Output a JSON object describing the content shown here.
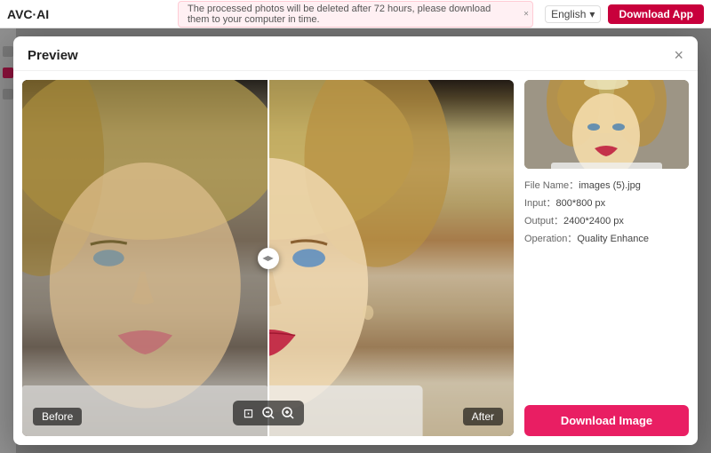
{
  "topbar": {
    "logo": "AVC·AI",
    "notification": "The processed photos will be deleted after 72 hours, please download them to your computer in time.",
    "notification_close": "×",
    "language": "English",
    "language_chevron": "▾",
    "download_app": "Download App"
  },
  "modal": {
    "title": "Preview",
    "close": "×",
    "label_before": "Before",
    "label_after": "After",
    "zoom_fit": "⊡",
    "zoom_out": "−",
    "zoom_in": "−"
  },
  "file_info": {
    "name_label": "File Name：",
    "name_value": "images (5).jpg",
    "input_label": "Input：",
    "input_value": "800*800 px",
    "output_label": "Output：",
    "output_value": "2400*2400 px",
    "operation_label": "Operation：",
    "operation_value": "Quality Enhance"
  },
  "actions": {
    "download_image": "Download Image"
  },
  "colors": {
    "primary": "#e91e63",
    "download_app": "#c8003c"
  }
}
